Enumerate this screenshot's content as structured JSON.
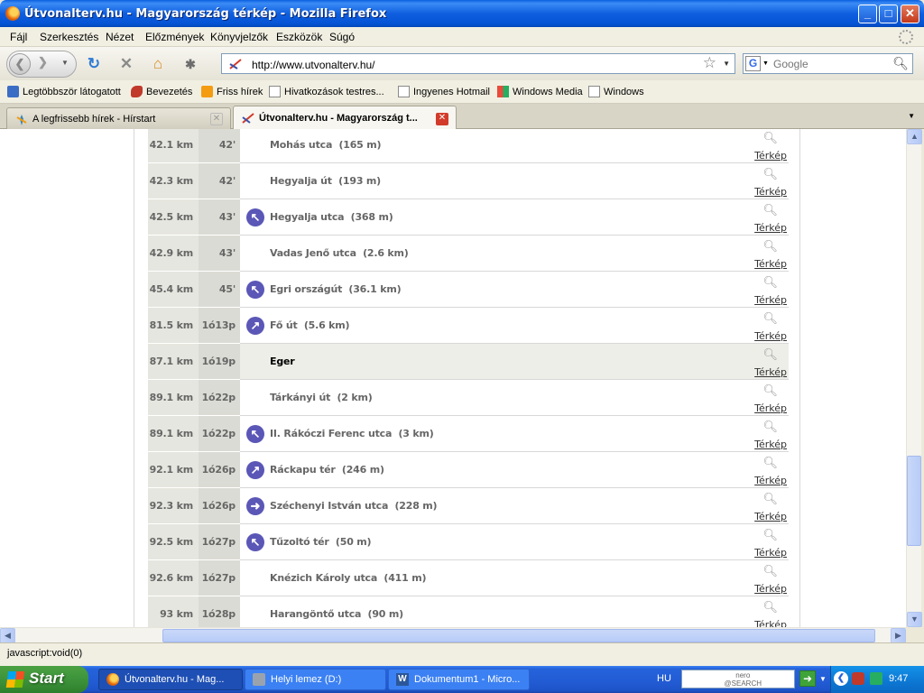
{
  "window": {
    "title": "Útvonalterv.hu - Magyarország térkép - Mozilla Firefox",
    "minimize": "_",
    "maximize": "□",
    "close": "✕"
  },
  "menu": [
    "Fájl",
    "Szerkesztés",
    "Nézet",
    "Előzmények",
    "Könyvjelzők",
    "Eszközök",
    "Súgó"
  ],
  "nav": {
    "url": "http://www.utvonalterv.hu/",
    "search_engine": "G",
    "search_placeholder": "Google",
    "icons": [
      "back-icon",
      "forward-icon",
      "reload-icon",
      "stop-icon",
      "home-icon",
      "addon-icon",
      "star-icon",
      "search-icon"
    ]
  },
  "bookmarks": [
    {
      "label": "Legtöbbször látogatott",
      "icon": "blue"
    },
    {
      "label": "Bevezetés",
      "icon": "red"
    },
    {
      "label": "Friss hírek",
      "icon": "feed"
    },
    {
      "label": "Hivatkozások testres...",
      "icon": "page"
    },
    {
      "label": "Ingyenes Hotmail",
      "icon": "page"
    },
    {
      "label": "Windows Media",
      "icon": "win"
    },
    {
      "label": "Windows",
      "icon": "page"
    }
  ],
  "tabs": [
    {
      "label": "A legfrissebb hírek - Hírstart",
      "active": false
    },
    {
      "label": "Útvonalterv.hu - Magyarország t...",
      "active": true
    }
  ],
  "route": {
    "map_label": "Térkép",
    "rows": [
      {
        "distance": "42.1 km",
        "time": "42'",
        "street": "Mohás utca",
        "length": "(165 m)",
        "turn": ""
      },
      {
        "distance": "42.3 km",
        "time": "42'",
        "street": "Hegyalja út",
        "length": "(193 m)",
        "turn": ""
      },
      {
        "distance": "42.5 km",
        "time": "43'",
        "street": "Hegyalja utca",
        "length": "(368 m)",
        "turn": "up-left"
      },
      {
        "distance": "42.9 km",
        "time": "43'",
        "street": "Vadas Jenő utca",
        "length": "(2.6 km)",
        "turn": ""
      },
      {
        "distance": "45.4 km",
        "time": "45'",
        "street": "Egri országút",
        "length": "(36.1 km)",
        "turn": "up-left"
      },
      {
        "distance": "81.5 km",
        "time": "1ó13p",
        "street": "Fő út",
        "length": "(5.6 km)",
        "turn": "up-right"
      },
      {
        "distance": "87.1 km",
        "time": "1ó19p",
        "street": "Eger",
        "length": "",
        "turn": "",
        "highlight": true
      },
      {
        "distance": "89.1 km",
        "time": "1ó22p",
        "street": "Tárkányi út",
        "length": "(2 km)",
        "turn": ""
      },
      {
        "distance": "89.1 km",
        "time": "1ó22p",
        "street": "II. Rákóczi Ferenc utca",
        "length": "(3 km)",
        "turn": "up-left"
      },
      {
        "distance": "92.1 km",
        "time": "1ó26p",
        "street": "Ráckapu tér",
        "length": "(246 m)",
        "turn": "up-right"
      },
      {
        "distance": "92.3 km",
        "time": "1ó26p",
        "street": "Széchenyi István utca",
        "length": "(228 m)",
        "turn": "right"
      },
      {
        "distance": "92.5 km",
        "time": "1ó27p",
        "street": "Tűzoltó tér",
        "length": "(50 m)",
        "turn": "up-left"
      },
      {
        "distance": "92.6 km",
        "time": "1ó27p",
        "street": "Knézich Károly utca",
        "length": "(411 m)",
        "turn": ""
      },
      {
        "distance": "93 km",
        "time": "1ó28p",
        "street": "Harangöntő utca",
        "length": "(90 m)",
        "turn": ""
      }
    ]
  },
  "status": "javascript:void(0)",
  "taskbar": {
    "start": "Start",
    "tasks": [
      {
        "label": "Útvonalterv.hu - Mag...",
        "active": true
      },
      {
        "label": "Helyi lemez (D:)",
        "active": false
      },
      {
        "label": "Dokumentum1 - Micro...",
        "active": false
      }
    ],
    "lang": "HU",
    "nero_logo_top": "nero",
    "nero_logo_bottom": "@SEARCH",
    "clock": "9:47"
  },
  "colors": {
    "titlebar": "#0453D4",
    "turn_badge": "#5A57B7",
    "taskbar": "#235DD6",
    "start": "#3D933A"
  }
}
